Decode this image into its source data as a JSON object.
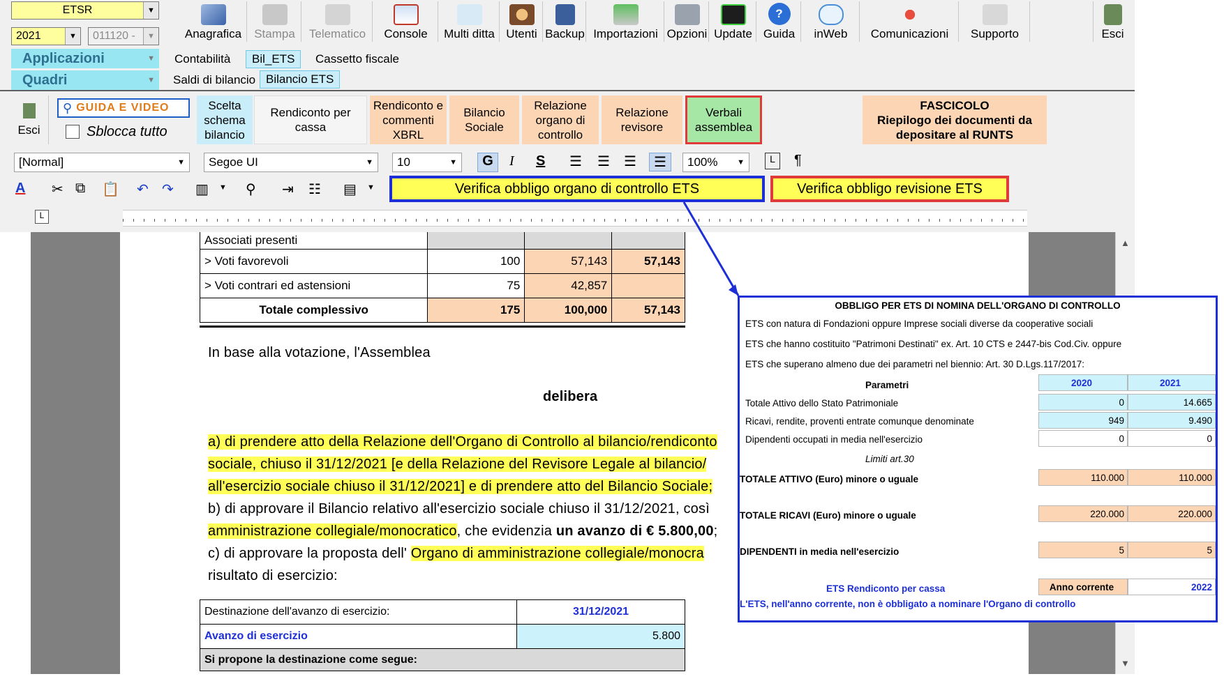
{
  "top": {
    "combo_company": "ETSR",
    "combo_year": "2021",
    "combo_code": "011120 -",
    "toolbar": [
      "Anagrafica",
      "Stampa",
      "Telematico",
      "Console",
      "Multi ditta",
      "Utenti",
      "Backup",
      "Importazioni",
      "Opzioni",
      "Update",
      "Guida",
      "inWeb",
      "Comunicazioni",
      "Supporto"
    ],
    "exit_label": "Esci",
    "applicazioni": "Applicazioni",
    "quadri": "Quadri",
    "tabs1": [
      "Contabilità",
      "Bil_ETS",
      "Cassetto fiscale"
    ],
    "tabs2": [
      "Saldi di bilancio",
      "Bilancio ETS"
    ]
  },
  "ribbon": {
    "esci": "Esci",
    "guida_video": "GUIDA E VIDEO",
    "sblocca": "Sblocca tutto",
    "buttons": [
      "Scelta schema bilancio",
      "Rendiconto per cassa",
      "Rendiconto e commenti XBRL",
      "Bilancio Sociale",
      "Relazione organo di controllo",
      "Relazione revisore",
      "Verbali assemblea"
    ],
    "fascicolo_title": "FASCICOLO",
    "fascicolo_sub": "Riepilogo dei documenti da depositare al RUNTS",
    "style": "[Normal]",
    "font": "Segoe UI",
    "size": "10",
    "zoom": "100%",
    "verifica_organo": "Verifica obbligo organo di controllo ETS",
    "verifica_revisione": "Verifica obbligo revisione ETS"
  },
  "doc": {
    "vote_header": "Associati presenti",
    "vote_rows": [
      {
        "label": "> Voti favorevoli",
        "n": "100",
        "pct": "57,143",
        "pct2": "57,143"
      },
      {
        "label": "> Voti contrari ed astensioni",
        "n": "75",
        "pct": "42,857",
        "pct2": ""
      },
      {
        "label": "Totale complessivo",
        "n": "175",
        "pct": "100,000",
        "pct2": "57,143"
      }
    ],
    "in_base": "In base alla votazione, l'Assemblea",
    "delibera": "delibera",
    "line_a1": "a) di prendere atto della Relazione dell'Organo di Controllo al bilancio/rendiconto",
    "line_a2": "sociale, chiuso il 31/12/2021 [e della Relazione del Revisore Legale al bilancio/",
    "line_a3": "all'esercizio sociale chiuso il 31/12/2021] e di prendere atto del Bilancio Sociale;",
    "line_b1": "b) di approvare il Bilancio relativo all'esercizio sociale chiuso il 31/12/2021, così",
    "line_b2a": "amministrazione collegiale/monocratico",
    "line_b2b": ", che evidenzia ",
    "line_b2c": "un avanzo di € 5.800,00",
    "line_b2d": ";",
    "line_c1a": "c) di approvare la proposta dell' ",
    "line_c1b": "Organo di amministrazione collegiale/monocra",
    "line_c2": "risultato di esercizio:",
    "dest_label": "Destinazione dell'avanzo di esercizio:",
    "dest_date": "31/12/2021",
    "avanzo_label": "Avanzo di esercizio",
    "avanzo_val": "5.800",
    "propone": "Si propone la destinazione come segue:"
  },
  "popup": {
    "title": "OBBLIGO PER ETS DI NOMINA DELL'ORGANO DI CONTROLLO",
    "line1": "ETS con natura di Fondazioni oppure Imprese sociali diverse da cooperative sociali",
    "line2": "ETS che hanno costituito \"Patrimoni Destinati\" ex. Art. 10 CTS e 2447-bis Cod.Civ. oppure",
    "line3": "ETS che superano almeno due dei parametri nel biennio: Art. 30 D.Lgs.117/2017:",
    "parametri": "Parametri",
    "y1": "2020",
    "y2": "2021",
    "rows": [
      {
        "label": "Totale Attivo dello Stato Patrimoniale",
        "v1": "0",
        "v2": "14.665"
      },
      {
        "label": "Ricavi, rendite, proventi entrate comunque denominate",
        "v1": "949",
        "v2": "9.490"
      },
      {
        "label": "Dipendenti occupati in media nell'esercizio",
        "v1": "0",
        "v2": "0"
      }
    ],
    "limiti": "Limiti art.30",
    "lim_rows": [
      {
        "label": "TOTALE ATTIVO (Euro) minore o uguale",
        "v1": "110.000",
        "v2": "110.000"
      },
      {
        "label": "TOTALE RICAVI (Euro) minore o uguale",
        "v1": "220.000",
        "v2": "220.000"
      },
      {
        "label": "DIPENDENTI in media nell'esercizio",
        "v1": "5",
        "v2": "5"
      }
    ],
    "ets_rendiconto": "ETS Rendiconto per cassa",
    "anno_corrente": "Anno corrente",
    "anno_val": "2022",
    "result": "L'ETS, nell'anno corrente, non è obbligato a nominare l'Organo di controllo"
  }
}
